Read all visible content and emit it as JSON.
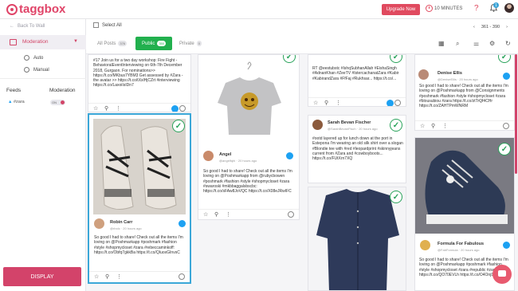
{
  "app": {
    "brand": "taggbox",
    "upgrade_label": "Upgrade Now",
    "timer": "10 MINUTES",
    "notif_count": "1"
  },
  "sidebar": {
    "back_label": "Back To Wall",
    "section": "Moderation",
    "subitems": [
      "Auto",
      "Manual"
    ],
    "feeds_label": "Feeds",
    "moderation_label": "Moderation",
    "feed_name": "#zara",
    "toggle_label": "ON",
    "display_label": "DISPLAY"
  },
  "header": {
    "select_all": "Select All",
    "tabs": [
      {
        "label": "All Posts",
        "count": "376"
      },
      {
        "label": "Public",
        "count": "350"
      },
      {
        "label": "Private",
        "count": "0"
      }
    ],
    "pager": "361 - 390"
  },
  "cards": {
    "c1_text": "#17 Join us for a two day workshop: Fire Fight - BehavioralEventInterviewing on 6th-7th December 2018, Gurgaon. For nominations>> https://t.co/MKbus7YBM3 Get assessed by #Zara - the avatar >> https://t.co/tXxlHjCZrt #interviewing https://t.co/LaxoiIsIDn7",
    "c2_user": "Robin Carr",
    "c2_stamp": "@rbolc · 20 hours ago",
    "c2_text": "So good I had to share! Check out all the items I'm loving on @Poshmarkapp #poshmark #fashion #style #shopmycloset #zara #rebeccaminkoff: https://t.co/Obfq7gkkBa https://t.co/QIuoxGInvsC",
    "c3_user": "Angel",
    "c3_stamp": "@angelfqhi · 20 hours ago",
    "c3_text": "So good I had to share! Check out all the items I'm loving on @Poshmarkapp from @rubycbowen #poshmark #fashion #style #shopmycloset #zara #swaroski #mkbbaggalsbscbc: https://t.co/sFAw8JoVQC https://t.co/X08eJRwIFC",
    "c4_text": "RT @eestubstc #IshqSubhanAllah #EishaSingh #AdnanKhan #ZeeTV #IstercachanatZara #Kabir #KabirandZara #FfFaj #Rukhsar... https://t.co/...",
    "c5_user": "Sarah Bevan Fischer",
    "c5_stamp": "@SarahBevanFisch · 20 hours ago",
    "c5_text": "#ootd layered up for lunch down at the port in Estepona I'm wearing an old silk shirt over a slogan #Blondie tee with #red #leopardprint #skinnyjeans current from #Zara and #cowboyboots... https://t.co/FUtXrn7XQ",
    "c6_user": "Denise Ellis",
    "c6_stamp": "@DeniseEllis · 20 hours ago",
    "c6_text": "So good I had to share! Check out all the items I'm loving on @Poshmarkapp from @Consignments #poshmark #fashion #style #shopmycloset #zara #blousubiou #zara https://t.co/ztTrQf4CHr https://t.co/ZAHTPmWNRM",
    "c7_user": "Formula For Fabulous",
    "c7_stamp": "@FabFormula · 20 hours ago",
    "c7_text": "So good I had to share! Check out all the items I'm loving on @Poshmarkapp #poshmark #fashion #style #shopmycloset #zara #republic #zara https://t.co/QO70EVLh https://t.co/O4OnjDEXe4"
  },
  "colors": {
    "accent": "#d3436a",
    "public_green": "#22b04e",
    "twitter": "#1da1f2",
    "selected_border": "#3ba7d8"
  }
}
